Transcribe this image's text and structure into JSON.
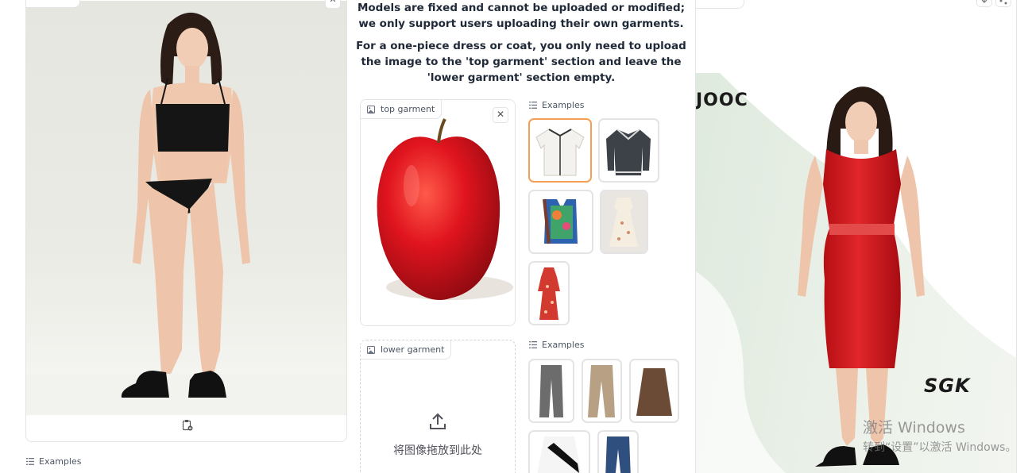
{
  "left_panel": {
    "close_icon": "close-icon",
    "clipboard_icon": "clipboard-icon",
    "examples_label": "Examples"
  },
  "notice": {
    "line1": "Models are fixed and cannot be uploaded or modified; we only support users uploading their own garments.",
    "line2": "For a one-piece dress or coat, you only need to upload the image to the 'top garment' section and leave the 'lower garment' section empty."
  },
  "top_garment": {
    "label": "top garment",
    "close_icon": "close-icon",
    "content": "red-apple-image"
  },
  "lower_garment": {
    "label": "lower garment",
    "upload_icon": "upload-icon",
    "drop_text": "将图像拖放到此处"
  },
  "top_examples": {
    "label": "Examples",
    "items": [
      "white-cardigan",
      "grey-knit-cardigan",
      "floral-vest",
      "floral-dress",
      "red-floral-dress"
    ]
  },
  "lower_examples": {
    "label": "Examples",
    "items": [
      "grey-trousers",
      "khaki-trousers",
      "brown-leather-skirt",
      "black-white-skirt",
      "blue-jeans"
    ]
  },
  "result_panel": {
    "brand_top": "JOOC",
    "brand_bottom": "SGK",
    "download_icon": "download-icon",
    "share_icon": "share-icon"
  },
  "windows_watermark": {
    "line1": "激活 Windows",
    "line2": "转到“设置”以激活 Windows。"
  },
  "colors": {
    "accent_selected": "#f59e55",
    "border": "#e4e4e7",
    "dress_red": "#d7191b"
  }
}
